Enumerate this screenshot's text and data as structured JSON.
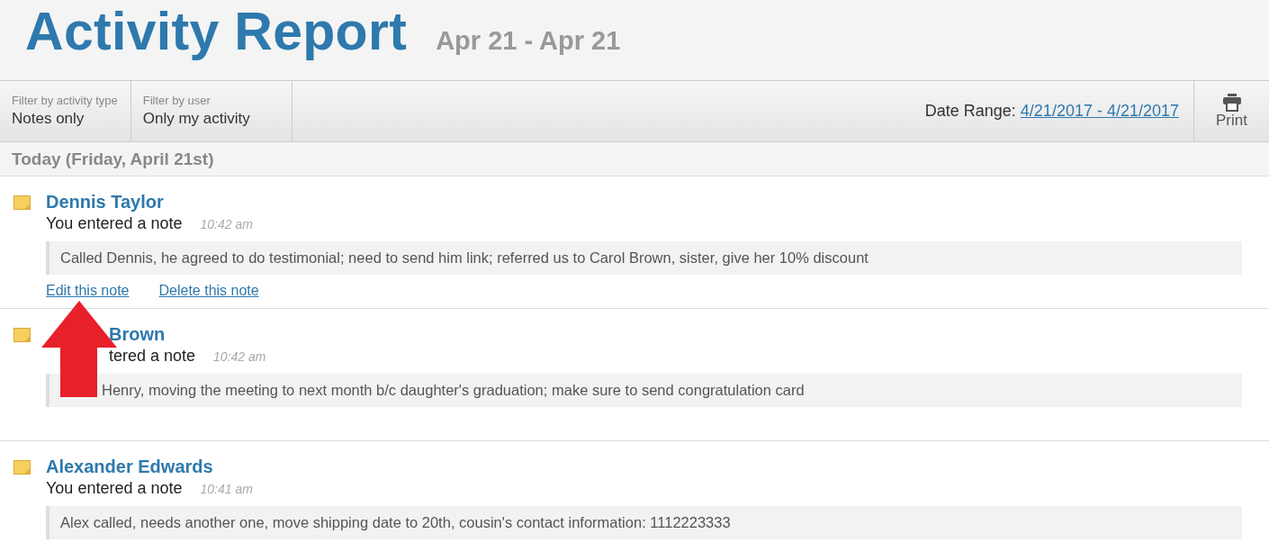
{
  "header": {
    "title": "Activity Report",
    "subtitle": "Apr 21 - Apr 21"
  },
  "filters": [
    {
      "label": "Filter by activity type",
      "value": "Notes only"
    },
    {
      "label": "Filter by user",
      "value": "Only my activity"
    }
  ],
  "date_range": {
    "label": "Date Range:",
    "value": "4/21/2017 - 4/21/2017"
  },
  "print": {
    "label": "Print"
  },
  "day_heading": "Today (Friday, April 21st)",
  "entries": [
    {
      "name": "Dennis Taylor",
      "action": "You entered a note",
      "time": "10:42 am",
      "note": "Called Dennis, he agreed to do testimonial; need to send him link; referred us to Carol Brown, sister, give her 10% discount",
      "links": [
        "Edit this note",
        "Delete this note"
      ],
      "obscured": false
    },
    {
      "name": "Brown",
      "action": "tered a note",
      "time": "10:42 am",
      "note": "Henry, moving the meeting to next month b/c daughter's graduation; make sure to send congratulation card",
      "obscured": true
    },
    {
      "name": "Alexander Edwards",
      "action": "You entered a note",
      "time": "10:41 am",
      "note": "Alex called, needs another one, move shipping date to 20th, cousin's contact information: 1112223333",
      "obscured": false
    }
  ],
  "annotation": {
    "kind": "arrow"
  }
}
